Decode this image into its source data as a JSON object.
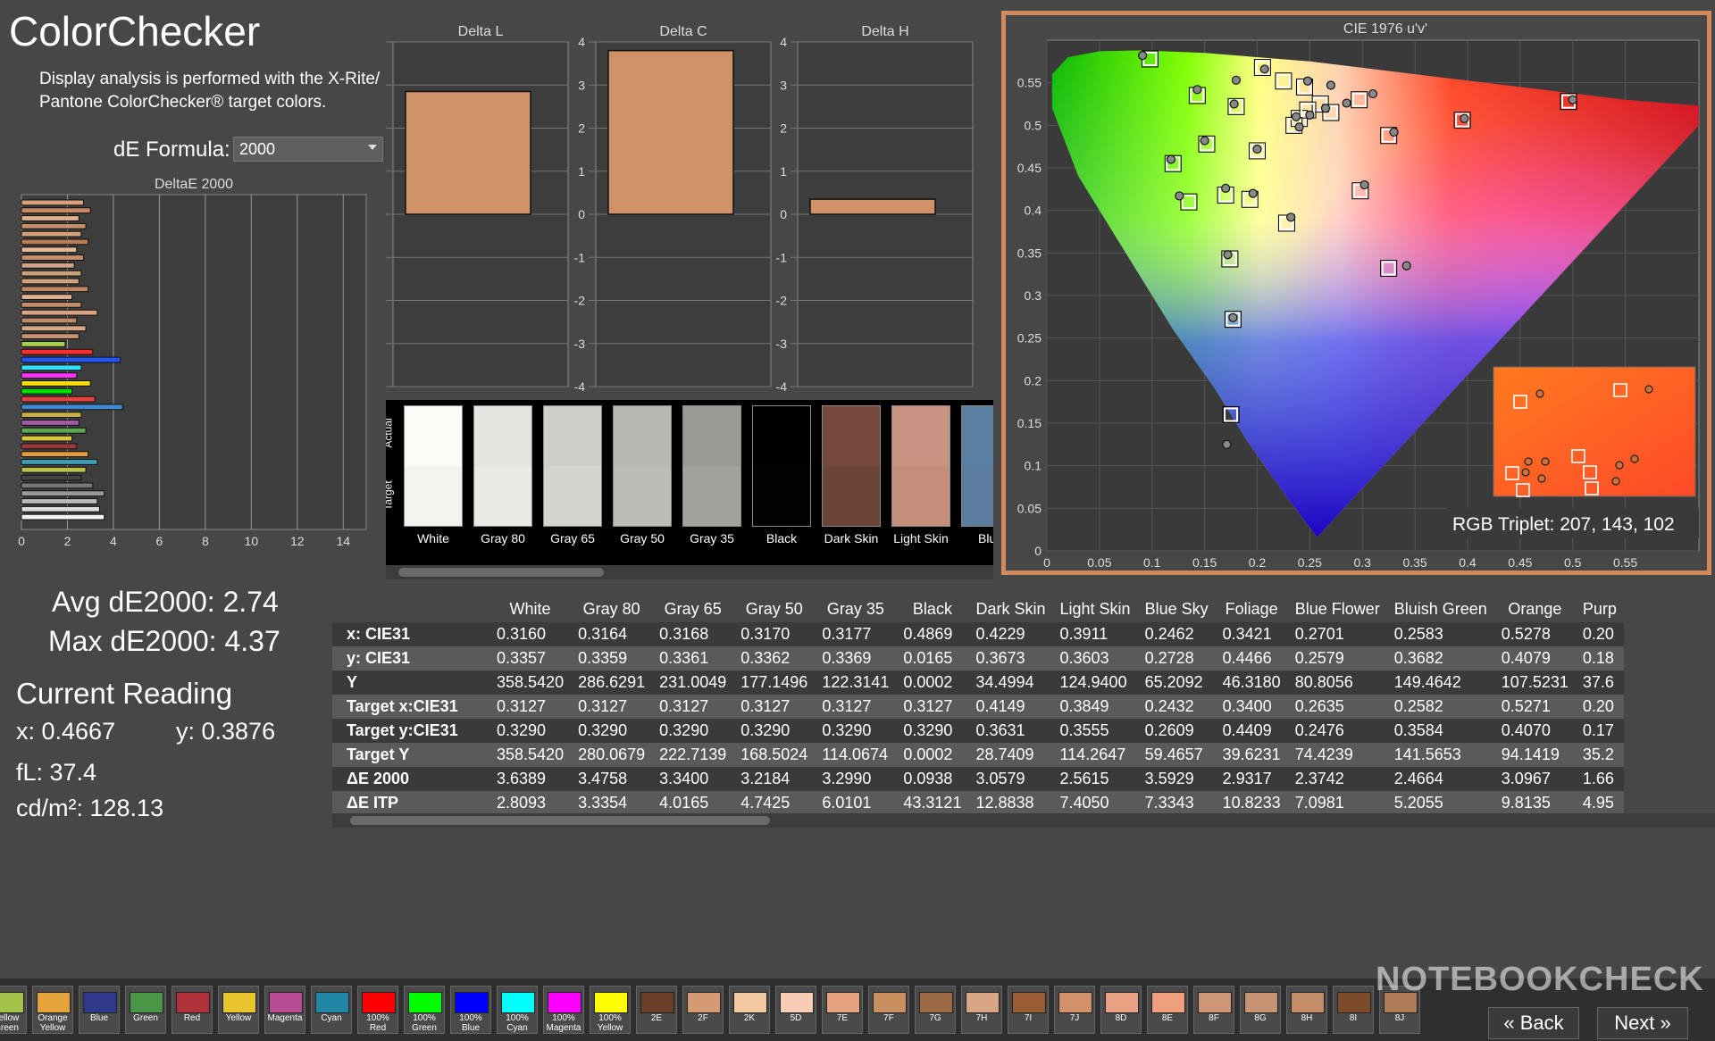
{
  "app": {
    "title": "ColorChecker",
    "description": "Display analysis is performed with the X-Rite/ Pantone ColorChecker® target colors.",
    "formula_label": "dE Formula:",
    "formula_value": "2000"
  },
  "stats": {
    "avg": "Avg dE2000: 2.74",
    "max": "Max dE2000: 4.37",
    "reading_title": "Current Reading",
    "x": "x: 0.4667",
    "y": "y: 0.3876",
    "fl": "fL: 37.4",
    "cdm2": "cd/m²: 128.13"
  },
  "delta_charts": {
    "l_title": "Delta L",
    "c_title": "Delta C",
    "h_title": "Delta H",
    "l_value": 2.85,
    "c_value": 3.8,
    "h_value": 0.35,
    "ticks": [
      "4",
      "3",
      "2",
      "1",
      "0",
      "-1",
      "-2",
      "-3",
      "-4"
    ]
  },
  "deltae_chart": {
    "title": "DeltaE 2000",
    "ticks": [
      "0",
      "2",
      "4",
      "6",
      "8",
      "10",
      "12",
      "14"
    ]
  },
  "swatches": {
    "actual_label": "Actual",
    "target_label": "Target",
    "items": [
      {
        "label": "White",
        "actual": "#fbfcf7",
        "target": "#f3f4ef"
      },
      {
        "label": "Gray 80",
        "actual": "#e4e4e0",
        "target": "#e9e9e5"
      },
      {
        "label": "Gray 65",
        "actual": "#cfcfca",
        "target": "#d4d4cf"
      },
      {
        "label": "Gray 50",
        "actual": "#b8b8b3",
        "target": "#bdbdb8"
      },
      {
        "label": "Gray 35",
        "actual": "#9a9a95",
        "target": "#a3a39e"
      },
      {
        "label": "Black",
        "actual": "#000000",
        "target": "#030303"
      },
      {
        "label": "Dark Skin",
        "actual": "#744a3c",
        "target": "#6b4536"
      },
      {
        "label": "Light Skin",
        "actual": "#c69480",
        "target": "#c38f7b"
      },
      {
        "label": "Blue",
        "actual": "#5b7fa3",
        "target": "#5c7d9e"
      }
    ]
  },
  "cie": {
    "title": "CIE 1976 u'v'",
    "rgb_triplet": "RGB Triplet: 207, 143, 102",
    "x_ticks": [
      "0",
      "0.05",
      "0.1",
      "0.15",
      "0.2",
      "0.25",
      "0.3",
      "0.35",
      "0.4",
      "0.45",
      "0.5",
      "0.55"
    ],
    "y_ticks": [
      "0",
      "0.05",
      "0.1",
      "0.15",
      "0.2",
      "0.25",
      "0.3",
      "0.35",
      "0.4",
      "0.45",
      "0.5",
      "0.55"
    ],
    "targets": [
      [
        0.098,
        0.578
      ],
      [
        0.205,
        0.568
      ],
      [
        0.143,
        0.535
      ],
      [
        0.225,
        0.552
      ],
      [
        0.245,
        0.545
      ],
      [
        0.297,
        0.53
      ],
      [
        0.26,
        0.525
      ],
      [
        0.24,
        0.508
      ],
      [
        0.235,
        0.5
      ],
      [
        0.27,
        0.515
      ],
      [
        0.248,
        0.518
      ],
      [
        0.325,
        0.488
      ],
      [
        0.395,
        0.506
      ],
      [
        0.496,
        0.528
      ],
      [
        0.2,
        0.47
      ],
      [
        0.152,
        0.478
      ],
      [
        0.12,
        0.455
      ],
      [
        0.135,
        0.41
      ],
      [
        0.17,
        0.418
      ],
      [
        0.193,
        0.413
      ],
      [
        0.298,
        0.423
      ],
      [
        0.228,
        0.385
      ],
      [
        0.174,
        0.343
      ],
      [
        0.325,
        0.332
      ],
      [
        0.177,
        0.272
      ],
      [
        0.175,
        0.16
      ],
      [
        0.18,
        0.522
      ]
    ],
    "actuals": [
      [
        0.091,
        0.582
      ],
      [
        0.207,
        0.566
      ],
      [
        0.143,
        0.542
      ],
      [
        0.18,
        0.553
      ],
      [
        0.178,
        0.525
      ],
      [
        0.248,
        0.552
      ],
      [
        0.27,
        0.547
      ],
      [
        0.31,
        0.537
      ],
      [
        0.265,
        0.52
      ],
      [
        0.237,
        0.51
      ],
      [
        0.24,
        0.498
      ],
      [
        0.285,
        0.526
      ],
      [
        0.25,
        0.512
      ],
      [
        0.33,
        0.492
      ],
      [
        0.397,
        0.508
      ],
      [
        0.5,
        0.53
      ],
      [
        0.2,
        0.472
      ],
      [
        0.15,
        0.482
      ],
      [
        0.118,
        0.46
      ],
      [
        0.126,
        0.417
      ],
      [
        0.17,
        0.426
      ],
      [
        0.196,
        0.42
      ],
      [
        0.302,
        0.43
      ],
      [
        0.232,
        0.392
      ],
      [
        0.172,
        0.348
      ],
      [
        0.342,
        0.335
      ],
      [
        0.177,
        0.274
      ],
      [
        0.171,
        0.125
      ]
    ]
  },
  "table": {
    "headers": [
      "",
      "White",
      "Gray 80",
      "Gray 65",
      "Gray 50",
      "Gray 35",
      "Black",
      "Dark Skin",
      "Light Skin",
      "Blue Sky",
      "Foliage",
      "Blue Flower",
      "Bluish Green",
      "Orange",
      "Purp"
    ],
    "rows": [
      [
        "x: CIE31",
        "0.3160",
        "0.3164",
        "0.3168",
        "0.3170",
        "0.3177",
        "0.4869",
        "0.4229",
        "0.3911",
        "0.2462",
        "0.3421",
        "0.2701",
        "0.2583",
        "0.5278",
        "0.20"
      ],
      [
        "y: CIE31",
        "0.3357",
        "0.3359",
        "0.3361",
        "0.3362",
        "0.3369",
        "0.0165",
        "0.3673",
        "0.3603",
        "0.2728",
        "0.4466",
        "0.2579",
        "0.3682",
        "0.4079",
        "0.18"
      ],
      [
        "Y",
        "358.5420",
        "286.6291",
        "231.0049",
        "177.1496",
        "122.3141",
        "0.0002",
        "34.4994",
        "124.9400",
        "65.2092",
        "46.3180",
        "80.8056",
        "149.4642",
        "107.5231",
        "37.6"
      ],
      [
        "Target x:CIE31",
        "0.3127",
        "0.3127",
        "0.3127",
        "0.3127",
        "0.3127",
        "0.3127",
        "0.4149",
        "0.3849",
        "0.2432",
        "0.3400",
        "0.2635",
        "0.2582",
        "0.5271",
        "0.20"
      ],
      [
        "Target y:CIE31",
        "0.3290",
        "0.3290",
        "0.3290",
        "0.3290",
        "0.3290",
        "0.3290",
        "0.3631",
        "0.3555",
        "0.2609",
        "0.4409",
        "0.2476",
        "0.3584",
        "0.4070",
        "0.17"
      ],
      [
        "Target Y",
        "358.5420",
        "280.0679",
        "222.7139",
        "168.5024",
        "114.0674",
        "0.0002",
        "28.7409",
        "114.2647",
        "59.4657",
        "39.6231",
        "74.4239",
        "141.5653",
        "94.1419",
        "35.2"
      ],
      [
        "ΔE 2000",
        "3.6389",
        "3.4758",
        "3.3400",
        "3.2184",
        "3.2990",
        "0.0938",
        "3.0579",
        "2.5615",
        "3.5929",
        "2.9317",
        "2.3742",
        "2.4664",
        "3.0967",
        "1.66"
      ],
      [
        "ΔE ITP",
        "2.8093",
        "3.3354",
        "4.0165",
        "4.7425",
        "6.0101",
        "43.3121",
        "12.8838",
        "7.4050",
        "7.3343",
        "10.8233",
        "7.0981",
        "5.2055",
        "9.8135",
        "4.95"
      ]
    ]
  },
  "patches": [
    {
      "label": "Yellow Green",
      "color": "#a3c24a"
    },
    {
      "label": "Orange Yellow",
      "color": "#e3a23a"
    },
    {
      "label": "Blue",
      "color": "#2d3a8c"
    },
    {
      "label": "Green",
      "color": "#4a9647"
    },
    {
      "label": "Red",
      "color": "#b0313a"
    },
    {
      "label": "Yellow",
      "color": "#e8c42e"
    },
    {
      "label": "Magenta",
      "color": "#b84c93"
    },
    {
      "label": "Cyan",
      "color": "#1f86a5"
    },
    {
      "label": "100% Red",
      "color": "#ff0000"
    },
    {
      "label": "100% Green",
      "color": "#00ff00"
    },
    {
      "label": "100% Blue",
      "color": "#0000ff"
    },
    {
      "label": "100% Cyan",
      "color": "#00ffff"
    },
    {
      "label": "100% Magenta",
      "color": "#ff00ff"
    },
    {
      "label": "100% Yellow",
      "color": "#ffff00"
    },
    {
      "label": "2E",
      "color": "#6a3f27"
    },
    {
      "label": "2F",
      "color": "#d69a73"
    },
    {
      "label": "2K",
      "color": "#f3c9a4"
    },
    {
      "label": "5D",
      "color": "#f6cdb4"
    },
    {
      "label": "7E",
      "color": "#e5a27d"
    },
    {
      "label": "7F",
      "color": "#c98f5f"
    },
    {
      "label": "7G",
      "color": "#9c6a47"
    },
    {
      "label": "7H",
      "color": "#d7a585"
    },
    {
      "label": "7I",
      "color": "#9a5c33"
    },
    {
      "label": "7J",
      "color": "#d3916a"
    },
    {
      "label": "8D",
      "color": "#e8a283"
    },
    {
      "label": "8E",
      "color": "#f09f7d"
    },
    {
      "label": "8F",
      "color": "#cf9577"
    },
    {
      "label": "8G",
      "color": "#c79272"
    },
    {
      "label": "8H",
      "color": "#c48d68"
    },
    {
      "label": "8I",
      "color": "#7b4b2c"
    },
    {
      "label": "8J",
      "color": "#b07b58"
    }
  ],
  "nav": {
    "back": "Back",
    "next": "Next"
  },
  "watermark": "NOTEBOOKCHECK",
  "colors": {
    "bar_fill": "#c9906c",
    "frame_accent": "#d28a5c"
  }
}
